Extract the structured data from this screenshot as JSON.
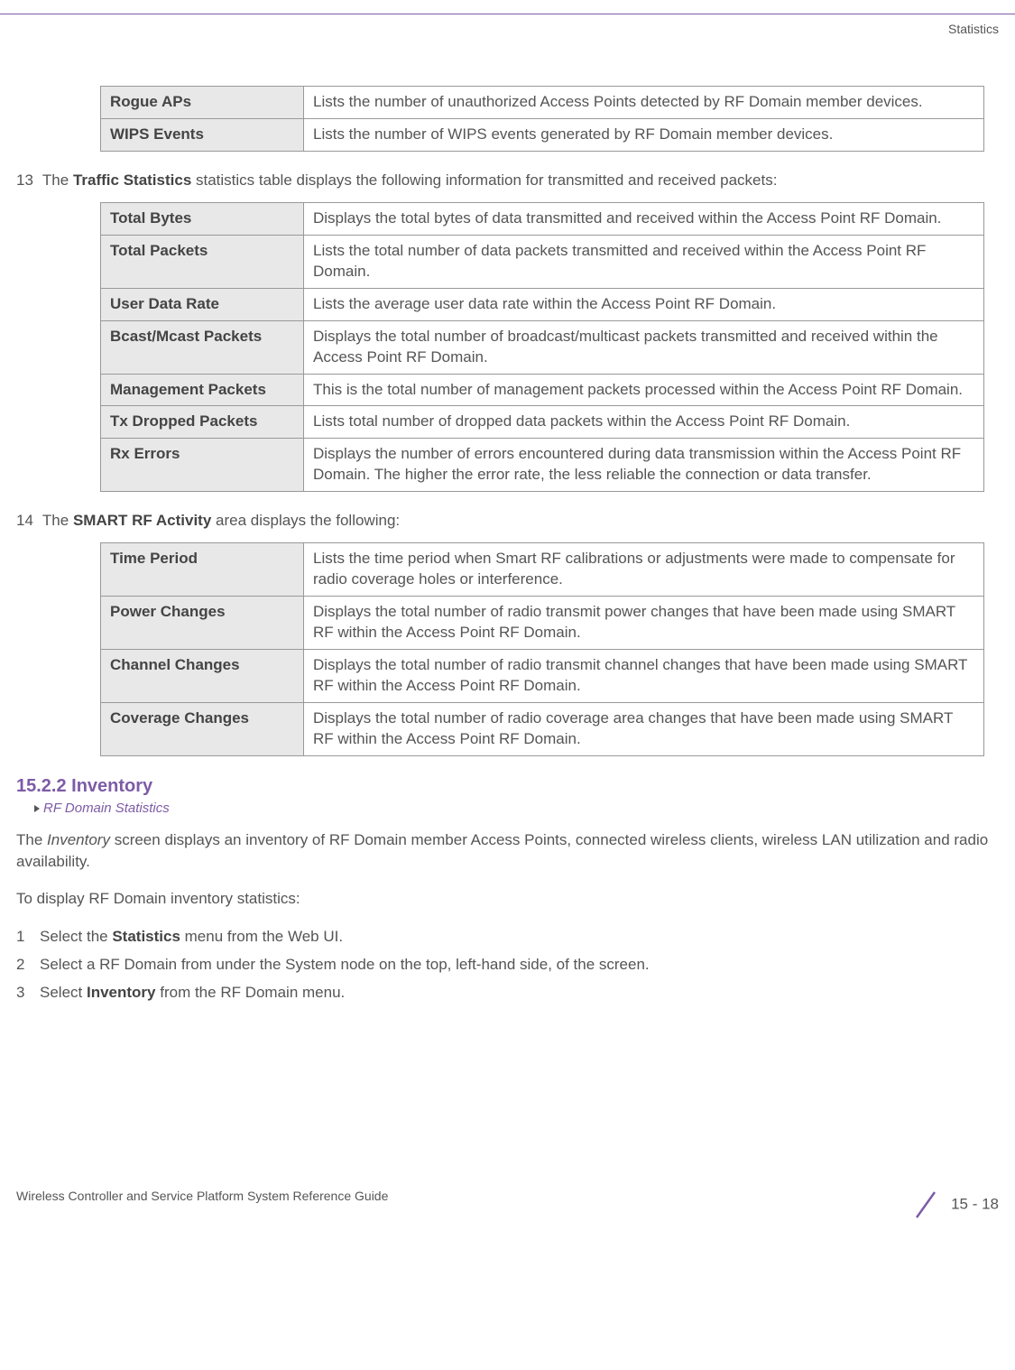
{
  "header_label": "Statistics",
  "table1": {
    "rows": [
      {
        "label": "Rogue APs",
        "desc": "Lists the number of unauthorized Access Points detected by RF Domain member devices."
      },
      {
        "label": "WIPS Events",
        "desc": "Lists the number of WIPS events generated by RF Domain member devices."
      }
    ]
  },
  "step13": {
    "num": "13",
    "pre": "The ",
    "bold": "Traffic Statistics",
    "post": " statistics table displays the following information for transmitted and received packets:"
  },
  "table2": {
    "rows": [
      {
        "label": "Total Bytes",
        "desc": "Displays the total bytes of data transmitted and received within the Access Point RF Domain."
      },
      {
        "label": "Total Packets",
        "desc": "Lists the total number of data packets transmitted and received within the Access Point RF Domain."
      },
      {
        "label": "User Data Rate",
        "desc": "Lists the average user data rate within the Access Point RF Domain."
      },
      {
        "label": "Bcast/Mcast Packets",
        "desc": "Displays the total number of broadcast/multicast packets transmitted and received within the Access Point RF Domain."
      },
      {
        "label": "Management Packets",
        "desc": "This is the total number of management packets processed within the Access Point RF Domain."
      },
      {
        "label": "Tx Dropped Packets",
        "desc": "Lists total number of dropped data packets within the Access Point RF Domain."
      },
      {
        "label": "Rx Errors",
        "desc": "Displays the number of errors encountered during data transmission within the Access Point RF Domain. The higher the error rate, the less reliable the connection or data transfer."
      }
    ]
  },
  "step14": {
    "num": "14",
    "pre": "The ",
    "bold": "SMART RF Activity",
    "post": " area displays the following:"
  },
  "table3": {
    "rows": [
      {
        "label": "Time Period",
        "desc": "Lists the time period when Smart RF calibrations or adjustments were made to compensate for radio coverage holes or interference."
      },
      {
        "label": "Power Changes",
        "desc": "Displays the total number of radio transmit power changes that have been made using SMART RF within the Access Point RF Domain."
      },
      {
        "label": "Channel Changes",
        "desc": "Displays the total number of radio transmit channel changes that have been made using SMART RF within the Access Point RF Domain."
      },
      {
        "label": "Coverage Changes",
        "desc": "Displays the total number of radio coverage area changes that have been made using SMART RF within the Access Point RF Domain."
      }
    ]
  },
  "section_heading": "15.2.2 Inventory",
  "breadcrumb": "RF Domain Statistics",
  "para1_pre": "The ",
  "para1_italic": "Inventory",
  "para1_post": " screen displays an inventory of RF Domain member Access Points, connected wireless clients, wireless LAN utilization and radio availability.",
  "para2": "To display RF Domain inventory statistics:",
  "steps": [
    {
      "n": "1",
      "pre": "Select the ",
      "bold": "Statistics",
      "post": " menu from the Web UI."
    },
    {
      "n": "2",
      "pre": "Select a RF Domain from under the System node on the top, left-hand side, of the screen.",
      "bold": "",
      "post": ""
    },
    {
      "n": "3",
      "pre": "Select ",
      "bold": "Inventory",
      "post": " from the RF Domain menu."
    }
  ],
  "footer_left": "Wireless Controller and Service Platform System Reference Guide",
  "footer_right": "15 - 18"
}
